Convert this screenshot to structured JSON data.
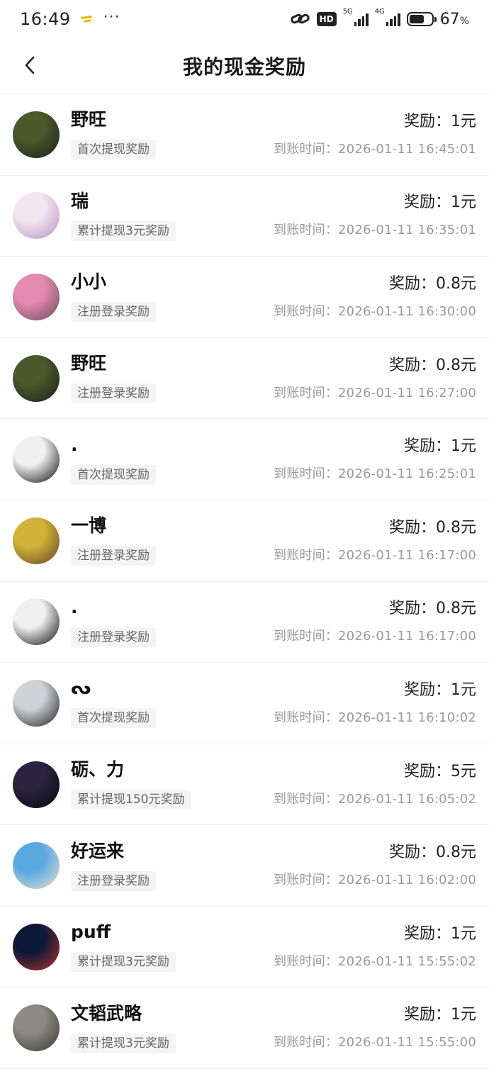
{
  "status": {
    "time": "16:49",
    "dots": "···",
    "hd": "HD",
    "gen1": "5G",
    "gen2": "4G",
    "battery_text": "67",
    "battery_unit": "%",
    "battery_level": 0.67
  },
  "header": {
    "title": "我的现金奖励"
  },
  "rows": [
    {
      "name": "野旺",
      "tag": "首次提现奖励",
      "reward": "奖励：1元",
      "time": "到账时间：2026-01-11 16:45:01",
      "avatar_colors": [
        "#4a5a2a",
        "#1c1c1c"
      ]
    },
    {
      "name": "瑞",
      "tag": "累计提现3元奖励",
      "reward": "奖励：1元",
      "time": "到账时间：2026-01-11 16:35:01",
      "avatar_colors": [
        "#f3e6ef",
        "#b490c6"
      ]
    },
    {
      "name": "小小",
      "tag": "注册登录奖励",
      "reward": "奖励：0.8元",
      "time": "到账时间：2026-01-11 16:30:00",
      "avatar_colors": [
        "#e58ab0",
        "#6b4a5a"
      ]
    },
    {
      "name": "野旺",
      "tag": "注册登录奖励",
      "reward": "奖励：0.8元",
      "time": "到账时间：2026-01-11 16:27:00",
      "avatar_colors": [
        "#4a5a2a",
        "#1c1c1c"
      ]
    },
    {
      "name": ".",
      "tag": "首次提现奖励",
      "reward": "奖励：1元",
      "time": "到账时间：2026-01-11 16:25:01",
      "avatar_colors": [
        "#f0f0f0",
        "#0a0a0a"
      ]
    },
    {
      "name": "一博",
      "tag": "注册登录奖励",
      "reward": "奖励：0.8元",
      "time": "到账时间：2026-01-11 16:17:00",
      "avatar_colors": [
        "#d4b23a",
        "#5a4620"
      ]
    },
    {
      "name": ".",
      "tag": "注册登录奖励",
      "reward": "奖励：0.8元",
      "time": "到账时间：2026-01-11 16:17:00",
      "avatar_colors": [
        "#f0f0f0",
        "#0a0a0a"
      ]
    },
    {
      "name": "ᔓ",
      "tag": "首次提现奖励",
      "reward": "奖励：1元",
      "time": "到账时间：2026-01-11 16:10:02",
      "avatar_colors": [
        "#cfd2d6",
        "#1e1e1e"
      ]
    },
    {
      "name": "砺、力",
      "tag": "累计提现150元奖励",
      "reward": "奖励：5元",
      "time": "到账时间：2026-01-11 16:05:02",
      "avatar_colors": [
        "#2a2440",
        "#05050a"
      ]
    },
    {
      "name": "好运来",
      "tag": "注册登录奖励",
      "reward": "奖励：0.8元",
      "time": "到账时间：2026-01-11 16:02:00",
      "avatar_colors": [
        "#5aa8e0",
        "#e9e2d0"
      ]
    },
    {
      "name": "puff",
      "tag": "累计提现3元奖励",
      "reward": "奖励：1元",
      "time": "到账时间：2026-01-11 15:55:02",
      "avatar_colors": [
        "#0c1838",
        "#b2342a"
      ]
    },
    {
      "name": "文韬武略",
      "tag": "累计提现3元奖励",
      "reward": "奖励：1元",
      "time": "到账时间：2026-01-11 15:55:00",
      "avatar_colors": [
        "#8c8a82",
        "#3a3530"
      ]
    }
  ]
}
